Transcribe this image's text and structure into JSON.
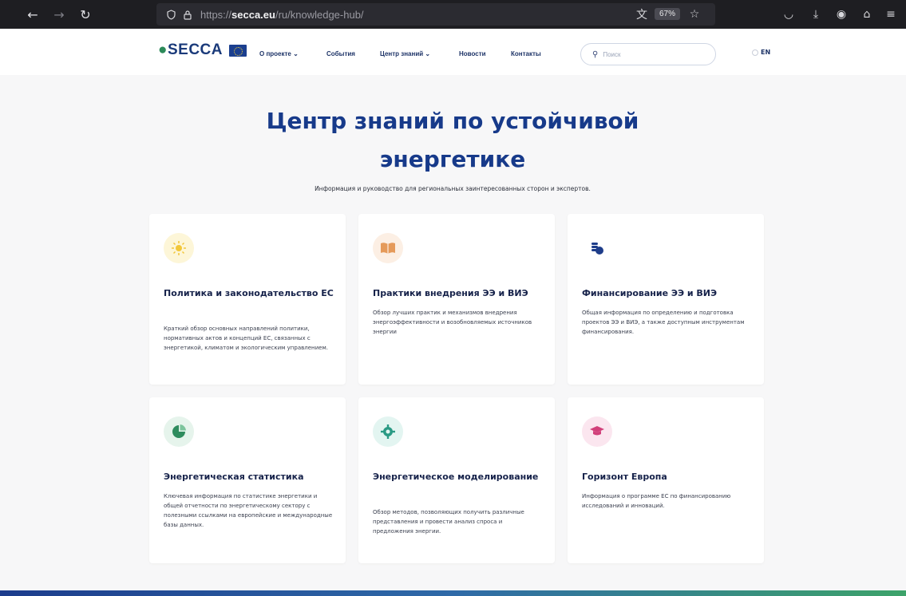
{
  "browser": {
    "url_prefix": "https://",
    "url_domain": "secca.eu",
    "url_path": "/ru/knowledge-hub/",
    "zoom": "67%"
  },
  "header": {
    "logo_text": "SECCA",
    "nav": [
      {
        "label": "О проекте ⌄"
      },
      {
        "label": "События"
      },
      {
        "label": "Центр знаний ⌄"
      },
      {
        "label": "Новости"
      },
      {
        "label": "Контакты"
      }
    ],
    "search_placeholder": "Поиск",
    "lang": "EN"
  },
  "hero": {
    "title_line1": "Центр знаний по устойчивой",
    "title_line2": "энергетике",
    "subtitle": "Информация и руководство для региональных заинтересованных сторон и экспертов."
  },
  "cards": [
    {
      "title": "Политика и законодательство ЕС",
      "desc": "Краткий обзор основных направлений политики, нормативных актов и концепций ЕС, связанных с энергетикой, климатом и экологическим управлением.",
      "icon": "sun-icon",
      "color": "#f2c73a"
    },
    {
      "title": "Практики внедрения ЭЭ и ВИЭ",
      "desc": "Обзор лучших практик и механизмов внедрения энергоэффективности и возобновляемых источников энергии",
      "icon": "book-icon",
      "color": "#e59a5a"
    },
    {
      "title": "Финансирование ЭЭ и ВИЭ",
      "desc": "Общая информация по определению и подготовка проектов ЭЭ и ВИЭ, а также доступным инструментам финансирования.",
      "icon": "coins-icon",
      "color": "#1e3d8a"
    },
    {
      "title": "Энергетическая статистика",
      "desc": "Ключевая информация по статистике энергетики и общей отчетности по энергетическому сектору с полезными ссылками на европейские и международные базы данных.",
      "icon": "pie-chart-icon",
      "color": "#2f8c5e"
    },
    {
      "title": "Энергетическое моделирование",
      "desc": "Обзор методов, позволяющих получить различные представления и провести анализ спроса и предложения энергии.",
      "icon": "gear-icon",
      "color": "#2a9a84"
    },
    {
      "title": "Горизонт Европа",
      "desc": "Информация о программе ЕС по финансированию исследований и инноваций.",
      "icon": "graduation-cap-icon",
      "color": "#d1407a"
    }
  ]
}
